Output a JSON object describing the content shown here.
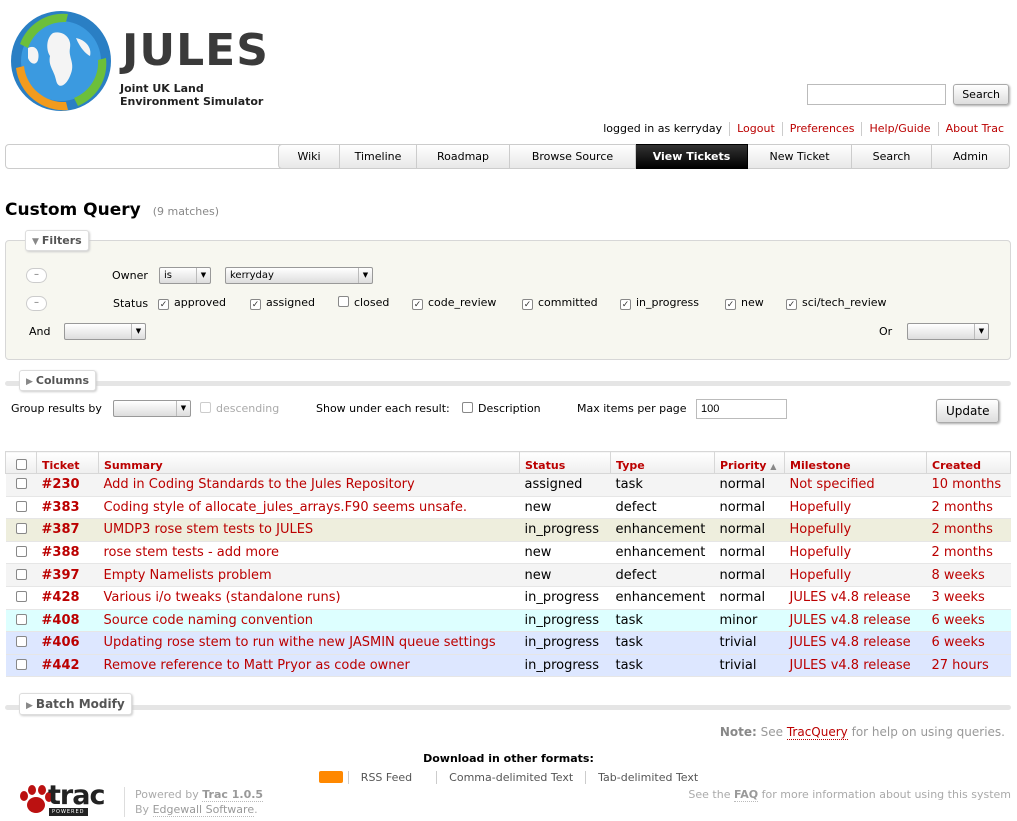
{
  "site": {
    "name": "JULES",
    "subtitle_line1": "Joint UK Land",
    "subtitle_line2": "Environment Simulator"
  },
  "search": {
    "placeholder": "",
    "button": "Search"
  },
  "metanav": [
    "logged in as kerryday",
    "Logout",
    "Preferences",
    "Help/Guide",
    "About Trac"
  ],
  "mainnav": [
    {
      "label": "Wiki",
      "active": false
    },
    {
      "label": "Timeline",
      "active": false
    },
    {
      "label": "Roadmap",
      "active": false
    },
    {
      "label": "Browse Source",
      "active": false
    },
    {
      "label": "View Tickets",
      "active": true
    },
    {
      "label": "New Ticket",
      "active": false
    },
    {
      "label": "Search",
      "active": false
    },
    {
      "label": "Admin",
      "active": false
    }
  ],
  "page": {
    "title": "Custom Query",
    "matches": "(9 matches)"
  },
  "filters": {
    "legend": "Filters",
    "owner_label": "Owner",
    "owner_op": "is",
    "owner_value": "kerryday",
    "status_label": "Status",
    "statuses": [
      {
        "name": "approved",
        "checked": true
      },
      {
        "name": "assigned",
        "checked": true
      },
      {
        "name": "closed",
        "checked": false
      },
      {
        "name": "code_review",
        "checked": true
      },
      {
        "name": "committed",
        "checked": true
      },
      {
        "name": "in_progress",
        "checked": true
      },
      {
        "name": "new",
        "checked": true
      },
      {
        "name": "sci/tech_review",
        "checked": true
      }
    ],
    "and_label": "And",
    "or_label": "Or",
    "minus": "–"
  },
  "columns_legend": "Columns",
  "options": {
    "group_label": "Group results by",
    "descending": "descending",
    "show_label": "Show under each result:",
    "description": "Description",
    "max_label": "Max items per page",
    "max_value": "100",
    "update": "Update"
  },
  "table": {
    "headers": [
      "Ticket",
      "Summary",
      "Status",
      "Type",
      "Priority",
      "Milestone",
      "Created"
    ],
    "sort_indicator": "▲",
    "rows": [
      {
        "id": "#230",
        "summary": "Add in Coding Standards to the Jules Repository",
        "status": "assigned",
        "type": "task",
        "priority": "normal",
        "milestone": "Not specified",
        "created": "10 months",
        "bg": "#f4f4f4"
      },
      {
        "id": "#383",
        "summary": "Coding style of allocate_jules_arrays.F90 seems unsafe.",
        "status": "new",
        "type": "defect",
        "priority": "normal",
        "milestone": "Hopefully",
        "created": "2 months",
        "bg": "#ffffff"
      },
      {
        "id": "#387",
        "summary": "UMDP3 rose stem tests to JULES",
        "status": "in_progress",
        "type": "enhancement",
        "priority": "normal",
        "milestone": "Hopefully",
        "created": "2 months",
        "bg": "#eeeedd"
      },
      {
        "id": "#388",
        "summary": "rose stem tests - add more",
        "status": "new",
        "type": "enhancement",
        "priority": "normal",
        "milestone": "Hopefully",
        "created": "2 months",
        "bg": "#ffffff"
      },
      {
        "id": "#397",
        "summary": "Empty Namelists problem",
        "status": "new",
        "type": "defect",
        "priority": "normal",
        "milestone": "Hopefully",
        "created": "8 weeks",
        "bg": "#f4f4f4"
      },
      {
        "id": "#428",
        "summary": "Various i/o tweaks (standalone runs)",
        "status": "in_progress",
        "type": "enhancement",
        "priority": "normal",
        "milestone": "JULES v4.8 release",
        "created": "3 weeks",
        "bg": "#ffffff"
      },
      {
        "id": "#408",
        "summary": "Source code naming convention",
        "status": "in_progress",
        "type": "task",
        "priority": "minor",
        "milestone": "JULES v4.8 release",
        "created": "6 weeks",
        "bg": "#ddffff"
      },
      {
        "id": "#406",
        "summary": "Updating rose stem to run withe new JASMIN queue settings",
        "status": "in_progress",
        "type": "task",
        "priority": "trivial",
        "milestone": "JULES v4.8 release",
        "created": "6 weeks",
        "bg": "#dde7ff"
      },
      {
        "id": "#442",
        "summary": "Remove reference to Matt Pryor as code owner",
        "status": "in_progress",
        "type": "task",
        "priority": "trivial",
        "milestone": "JULES v4.8 release",
        "created": "27 hours",
        "bg": "#dde7ff"
      }
    ]
  },
  "batch_legend": "Batch Modify",
  "footnote": {
    "note": "Note:",
    "see": "See",
    "link": "TracQuery",
    "rest": "for help on using queries."
  },
  "altlinks": {
    "heading": "Download in other formats:",
    "items": [
      "RSS Feed",
      "Comma-delimited Text",
      "Tab-delimited Text"
    ]
  },
  "footer": {
    "trac_logo": "trac",
    "trac_logo_small": "POWERED",
    "powered_by": "Powered by",
    "trac_version": "Trac 1.0.5",
    "by": "By",
    "edgewall": "Edgewall Software",
    "period": ".",
    "right_pre": "See the",
    "faq": "FAQ",
    "right_post": "for more information about using this system"
  }
}
